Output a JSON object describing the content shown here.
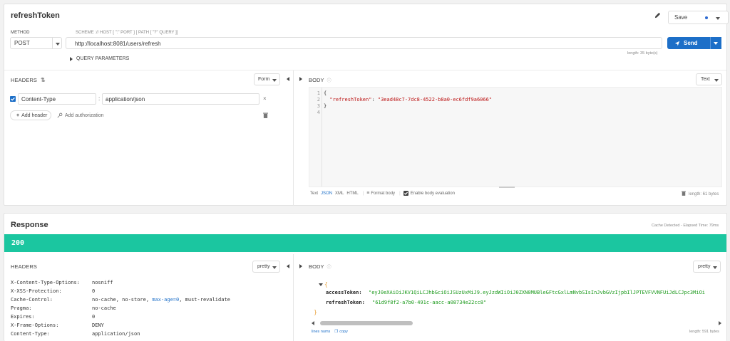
{
  "request": {
    "title": "refreshToken",
    "save_label": "Save",
    "method_label": "METHOD",
    "method": "POST",
    "url_label": "SCHEME :// HOST [ \":\" PORT ] [ PATH [ \"?\" QUERY ]]",
    "url": "http://localhost:8081/users/refresh",
    "send_label": "Send",
    "length_info": "length: 35 byte(s)",
    "query_params_label": "QUERY PARAMETERS",
    "headers_label": "HEADERS",
    "headers_mode": "Form",
    "header_key": "Content-Type",
    "header_value": "application/json",
    "add_header_label": "Add header",
    "add_auth_label": "Add authorization",
    "body_label": "BODY",
    "body_mode": "Text",
    "body_lines": [
      "{",
      "  \"refreshToken\": \"3ead48c7-7dc8-4522-b8a0-ec6fdf9a6066\"",
      "}",
      ""
    ],
    "line_numbers": [
      "1",
      "2",
      "3",
      "4"
    ],
    "format_tabs": [
      "Text",
      "JSON",
      "XML",
      "HTML"
    ],
    "format_body_label": "Format body",
    "enable_eval_label": "Enable body evaluation",
    "body_length": "length: 61 bytes"
  },
  "response": {
    "title": "Response",
    "cache_info": "Cache Detected - Elapsed Time: 79ms",
    "status": "200",
    "status_color": "#1bc6a0",
    "headers_label": "HEADERS",
    "headers_mode": "pretty",
    "headers": [
      {
        "name": "X-Content-Type-Options:",
        "value": "nosniff"
      },
      {
        "name": "X-XSS-Protection:",
        "value": "0"
      },
      {
        "name": "Cache-Control:",
        "value": "no-cache, no-store, max-age=0, must-revalidate"
      },
      {
        "name": "Pragma:",
        "value": "no-cache"
      },
      {
        "name": "Expires:",
        "value": "0"
      },
      {
        "name": "X-Frame-Options:",
        "value": "DENY"
      },
      {
        "name": "Content-Type:",
        "value": "application/json"
      }
    ],
    "body_label": "BODY",
    "body_mode": "pretty",
    "json_open": "{",
    "json_close": "}",
    "access_key": "accessToken:",
    "access_value": "\"eyJ0eXAiOiJKV1QiLCJhbGciOiJSUzUxMiJ9.eyJzdWIiOiJ0ZXN0MUBleGFtcGxlLmNvbSIsInJvbGVzIjpbIlJPTEVFVVNFUiJdLCJpc3MiOi",
    "refresh_key": "refreshToken:",
    "refresh_value": "\"61d9f8f2-a7b0-491c-aacc-a08734e22cc8\"",
    "lines_label": "lines nums",
    "copy_label": "copy",
    "length_info": "length: 591 bytes"
  }
}
